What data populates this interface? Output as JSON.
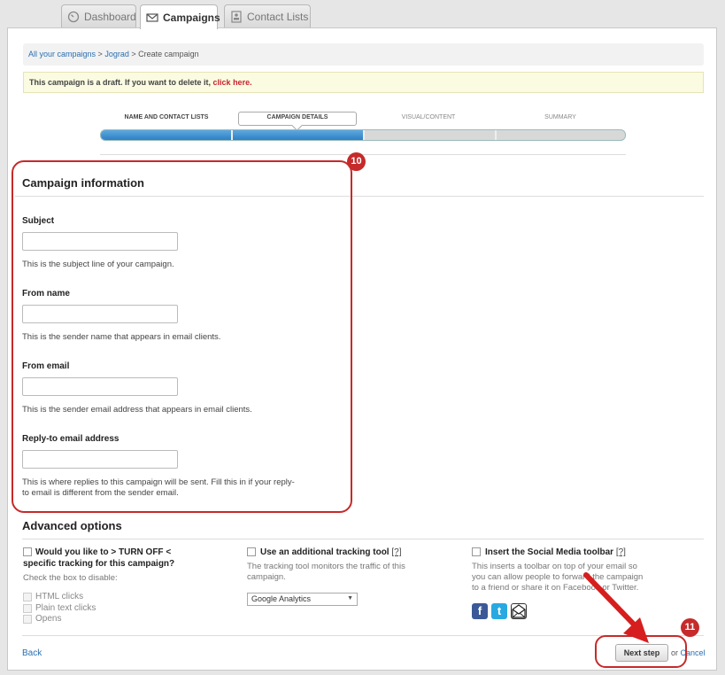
{
  "tabs": [
    {
      "label": "Dashboard",
      "icon": "dashboard-icon"
    },
    {
      "label": "Campaigns",
      "icon": "envelope-icon"
    },
    {
      "label": "Contact Lists",
      "icon": "contacts-icon"
    }
  ],
  "breadcrumb": {
    "crumb1": "All your campaigns",
    "sep1": " > ",
    "crumb2": "Jograd",
    "sep2": " > ",
    "current": "Create campaign"
  },
  "draft": {
    "text": "This campaign is a draft. If you want to delete it, ",
    "link": "click here."
  },
  "steps": [
    {
      "label": "NAME AND CONTACT LISTS",
      "done": true
    },
    {
      "label": "CAMPAIGN DETAILS",
      "done": true
    },
    {
      "label": "VISUAL/CONTENT",
      "done": false
    },
    {
      "label": "SUMMARY",
      "done": false
    }
  ],
  "progress": 0.5,
  "campaign_info": {
    "title": "Campaign information",
    "fields": [
      {
        "label": "Subject",
        "value": "",
        "help": "This is the subject line of your campaign."
      },
      {
        "label": "From name",
        "value": "",
        "help": "This is the sender name that appears in email clients."
      },
      {
        "label": "From email",
        "value": "",
        "help": "This is the sender email address that appears in email clients."
      },
      {
        "label": "Reply-to email address",
        "value": "",
        "help_line1": "This is where replies to this campaign will be sent. Fill this in if your reply-",
        "help_line2": "to email is different from the sender email."
      }
    ]
  },
  "annotations": {
    "badge10": "10",
    "badge11": "11"
  },
  "advanced": {
    "title": "Advanced options",
    "turnoff": {
      "title_line1": "Would you like to > TURN OFF <",
      "title_line2": "specific tracking for this campaign?",
      "help": "Check the box to disable:",
      "options": [
        "HTML clicks",
        "Plain text clicks",
        "Opens"
      ]
    },
    "tracking": {
      "title": "Use an additional tracking tool",
      "q": "[?]",
      "help_line1": "The tracking tool monitors the traffic of this",
      "help_line2": "campaign.",
      "selected": "Google Analytics"
    },
    "social": {
      "title": "Insert the Social Media toolbar",
      "q": "[?]",
      "help_line1": "This inserts a toolbar on top of your email so",
      "help_line2": "you can allow people to forward the campaign",
      "help_line3": "to a friend or share it on Facebook or Twitter.",
      "icons": [
        "facebook-icon",
        "twitter-icon",
        "forward-email-icon"
      ]
    }
  },
  "footer": {
    "back": "Back",
    "next": "Next step",
    "or": "or ",
    "cancel": "Cancel"
  },
  "colors": {
    "accent": "#2d80c6",
    "annotation": "#c62a2a",
    "link": "#2a6fb0"
  }
}
